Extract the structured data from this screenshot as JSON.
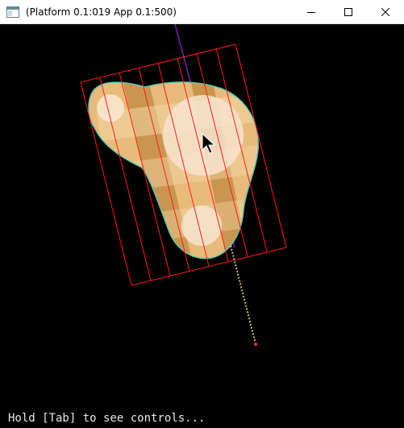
{
  "window": {
    "title": "(Platform 0.1:019 App 0.1:500)",
    "controls": {
      "minimize": "minimize-icon",
      "maximize": "maximize-icon",
      "close": "close-icon"
    }
  },
  "viewport": {
    "background_color": "#000000",
    "shape_fill_color": "#e8bb7a",
    "stripe_color": "#c48f48",
    "outline_color": "#5fc9b0",
    "hull_color": "#ff1a1a",
    "axis_color": "#7a1fa8",
    "ray_color": "#f0e27a",
    "cursor_icon": "mouse-pointer-icon"
  },
  "footer": {
    "hint": "Hold [Tab] to see controls..."
  }
}
